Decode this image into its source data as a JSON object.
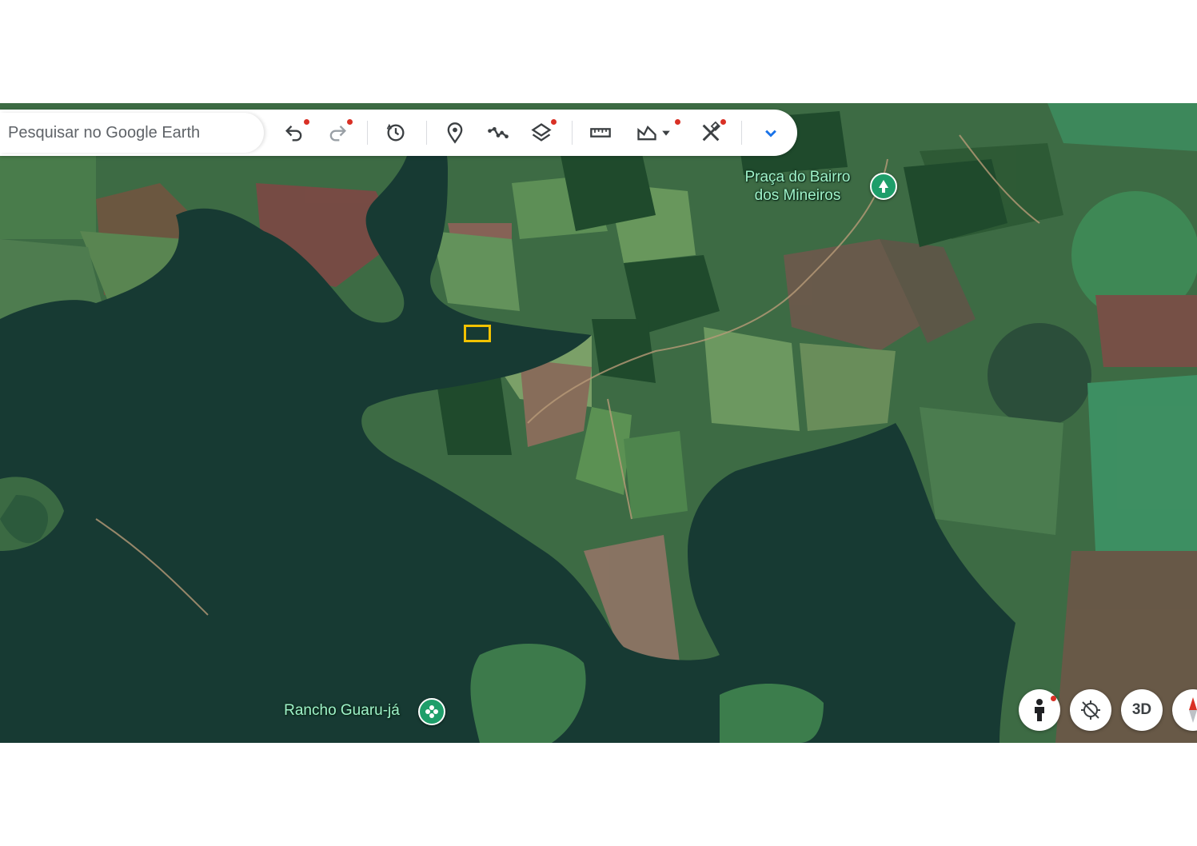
{
  "search": {
    "placeholder": "Pesquisar no Google Earth"
  },
  "toolbar": {
    "buttons": [
      {
        "id": "undo",
        "icon": "undo-icon",
        "has_dot": true
      },
      {
        "id": "redo",
        "icon": "redo-icon",
        "has_dot": true
      },
      {
        "id": "historical",
        "icon": "historical-imagery-icon",
        "has_dot": false
      },
      {
        "id": "placemark",
        "icon": "placemark-pin-icon",
        "has_dot": false
      },
      {
        "id": "path",
        "icon": "path-polygon-icon",
        "has_dot": false
      },
      {
        "id": "layers",
        "icon": "layers-icon",
        "has_dot": true
      },
      {
        "id": "measure",
        "icon": "ruler-icon",
        "has_dot": false
      },
      {
        "id": "map-style",
        "icon": "map-style-icon",
        "has_dot": true
      },
      {
        "id": "tools",
        "icon": "tools-icon",
        "has_dot": true
      },
      {
        "id": "more",
        "icon": "chevron-down-icon",
        "has_dot": false
      }
    ]
  },
  "places": [
    {
      "name": "Praça do Bairro dos Mineiros",
      "line1": "Praça do Bairro",
      "line2": "dos Mineiros",
      "icon": "park-tree-icon"
    },
    {
      "name": "Rancho Guaru-já",
      "icon": "flower-icon"
    }
  ],
  "controls": {
    "pegman": "pegman-icon",
    "location": "location-off-icon",
    "view_3d": "3D",
    "compass": "compass-icon"
  },
  "colors": {
    "accent_blue": "#1a73e8",
    "notification_dot": "#d93025",
    "place_pin": "#1e9e6a",
    "selection_box": "#f2c200",
    "water": "#173a33"
  }
}
